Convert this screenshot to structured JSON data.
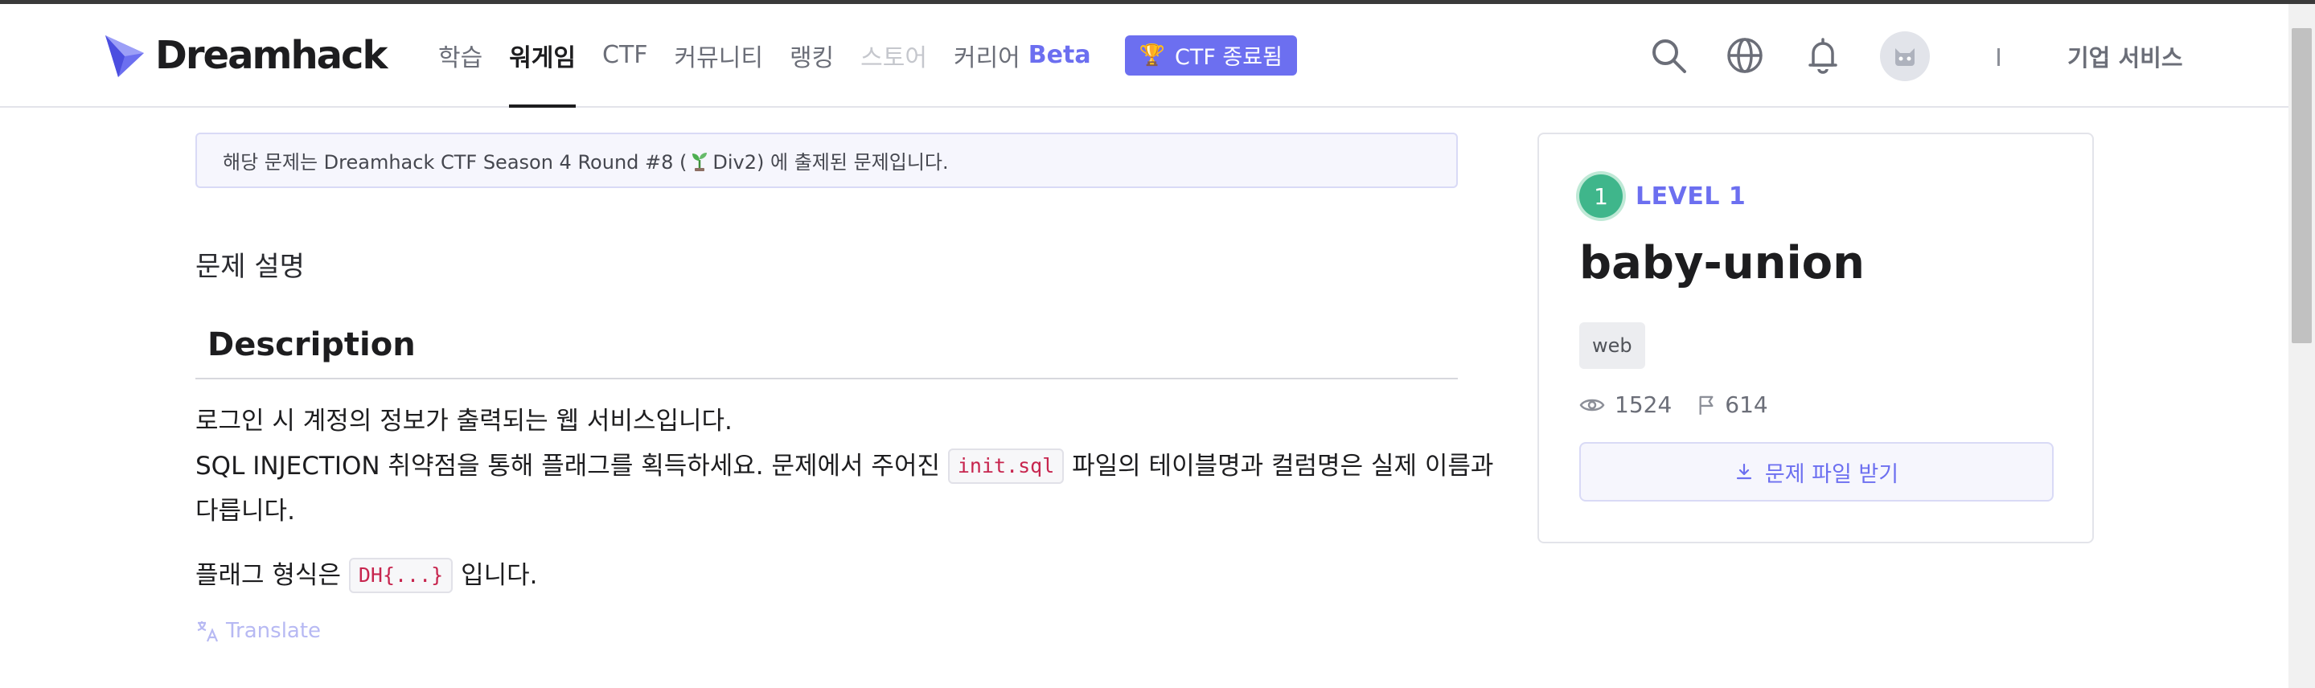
{
  "header": {
    "logo_text": "Dreamhack",
    "nav": [
      {
        "label": "학습",
        "state": "normal"
      },
      {
        "label": "워게임",
        "state": "active"
      },
      {
        "label": "CTF",
        "state": "normal"
      },
      {
        "label": "커뮤니티",
        "state": "normal"
      },
      {
        "label": "랭킹",
        "state": "normal"
      },
      {
        "label": "스토어",
        "state": "disabled"
      },
      {
        "label": "커리어",
        "state": "normal",
        "suffix": "Beta"
      }
    ],
    "ctf_badge": "CTF 종료됨",
    "corp_service": "기업 서비스",
    "icons": [
      "search-icon",
      "globe-icon",
      "bell-icon",
      "avatar"
    ]
  },
  "notice": {
    "before": "해당 문제는 Dreamhack CTF Season 4 Round #8 (",
    "after": "Div2) 에 출제된 문제입니다."
  },
  "content": {
    "section_title": "문제 설명",
    "description_heading": "Description",
    "line1": "로그인 시 계정의 정보가 출력되는 웹 서비스입니다.",
    "line2_before": "SQL INJECTION 취약점을 통해 플래그를 획득하세요. 문제에서 주어진",
    "line2_code": "init.sql",
    "line2_after": "파일의 테이블명과 컬럼명은 실제 이름과",
    "line3": "다릅니다.",
    "line4_before": "플래그 형식은",
    "line4_code": "DH{...}",
    "line4_after": "입니다.",
    "translate": "Translate"
  },
  "card": {
    "level_number": "1",
    "level_label": "LEVEL 1",
    "title": "baby-union",
    "tag": "web",
    "views": "1524",
    "solves": "614",
    "download_label": "문제 파일 받기"
  },
  "colors": {
    "accent": "#6c6ff0",
    "level_green": "#3fb68b",
    "code_red": "#c7254e"
  }
}
